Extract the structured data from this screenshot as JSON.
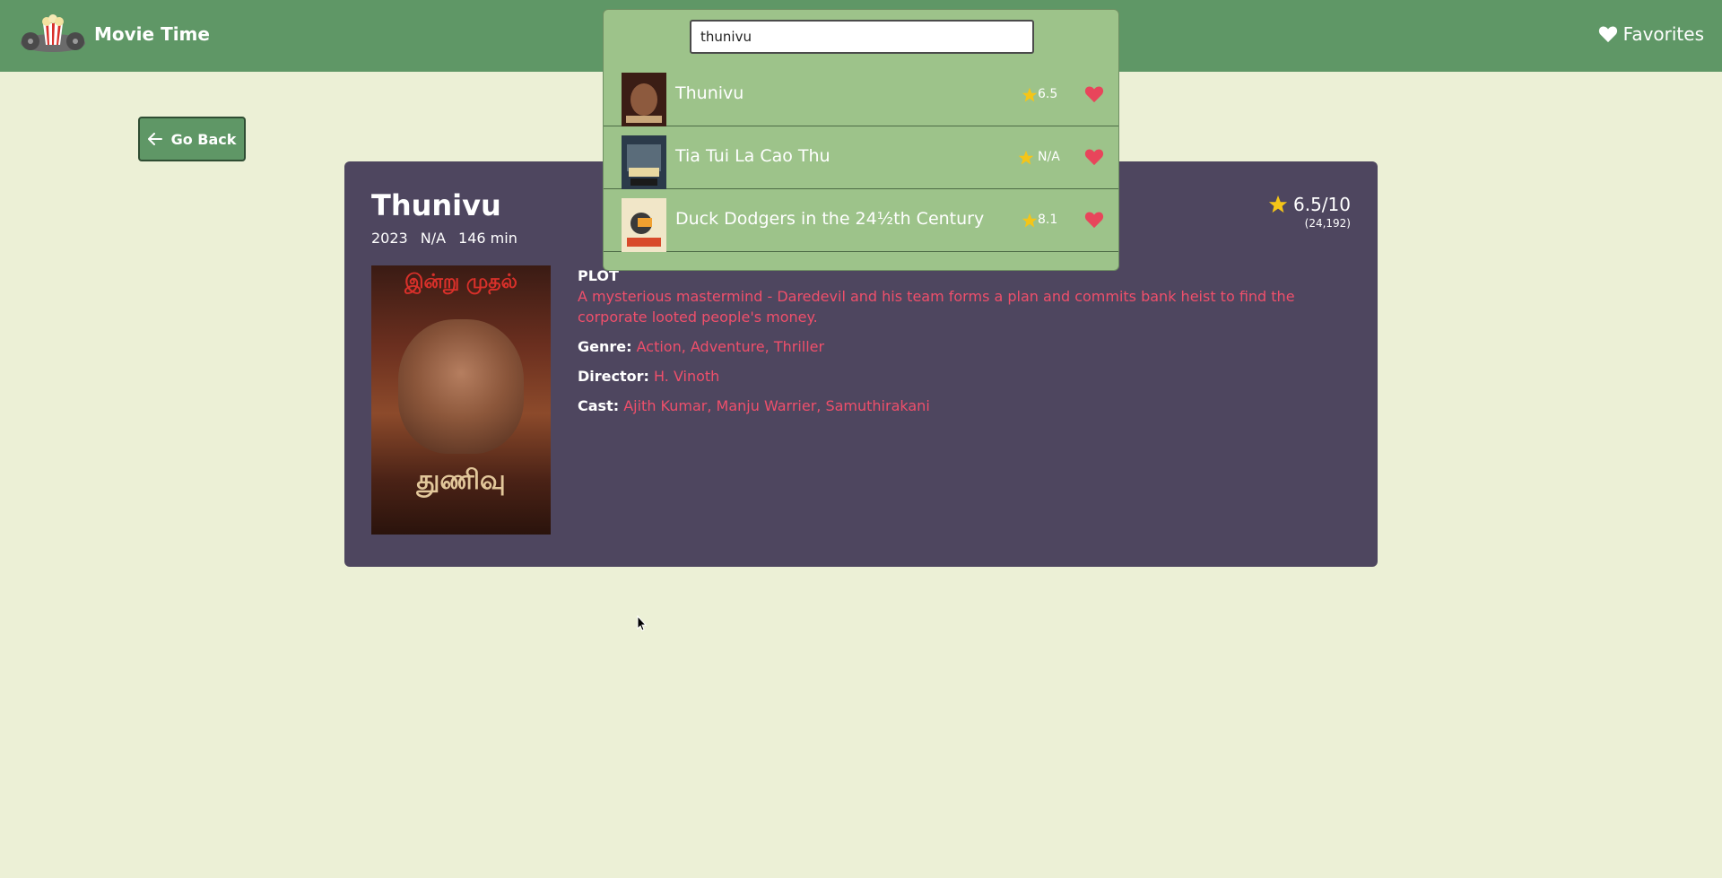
{
  "header": {
    "app_title": "Movie Time",
    "favorites_label": "Favorites"
  },
  "nav": {
    "go_back_label": "Go Back"
  },
  "search": {
    "value": "thunivu",
    "results": [
      {
        "title": "Thunivu",
        "rating": "6.5"
      },
      {
        "title": "Tia Tui La Cao Thu",
        "rating": "N/A"
      },
      {
        "title": "Duck Dodgers in the 24½th Century",
        "rating": "8.1"
      }
    ]
  },
  "movie": {
    "title": "Thunivu",
    "year": "2023",
    "rated": "N/A",
    "runtime": "146 min",
    "rating": "6.5/10",
    "votes": "(24,192)",
    "plot_heading": "PLOT",
    "plot": "A mysterious mastermind - Daredevil and his team forms a plan and commits bank heist to find the corporate looted people's money.",
    "genre_label": "Genre:",
    "genre": "Action, Adventure, Thriller",
    "director_label": "Director:",
    "director": "H. Vinoth",
    "cast_label": "Cast:",
    "cast": "Ajith Kumar, Manju Warrier, Samuthirakani"
  },
  "colors": {
    "header_bg": "#5f9766",
    "page_bg": "#ecf0d6",
    "card_bg": "#4e465f",
    "accent_text": "#ef4f6b",
    "star": "#f5c518",
    "heart": "#e8455b",
    "search_panel_bg": "#9dc38a"
  },
  "icons": {
    "logo": "film-reel-logo",
    "favorites": "heart-icon",
    "back": "arrow-left-icon",
    "rating": "star-icon"
  }
}
